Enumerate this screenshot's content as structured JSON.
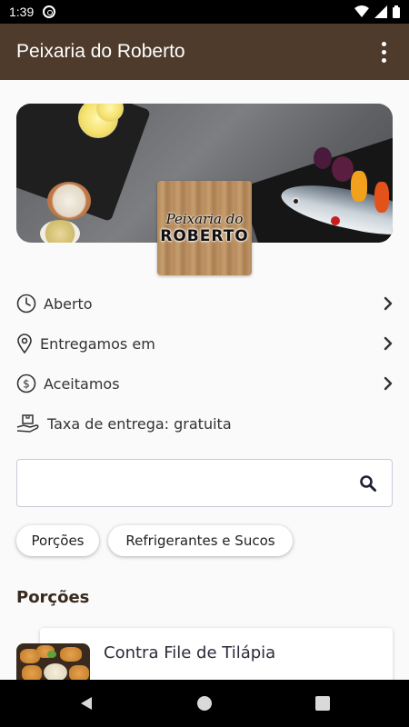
{
  "status": {
    "time": "1:39"
  },
  "app": {
    "title": "Peixaria do Roberto"
  },
  "logo": {
    "line1": "Peixaria do",
    "line2": "ROBERTO"
  },
  "info": [
    {
      "label": "Aberto",
      "icon": "clock-icon"
    },
    {
      "label": "Entregamos em",
      "icon": "location-pin-icon"
    },
    {
      "label": "Aceitamos",
      "icon": "dollar-icon"
    },
    {
      "label": "Taxa de entrega: gratuita",
      "icon": "delivery-hand-icon"
    }
  ],
  "search": {
    "value": "",
    "placeholder": ""
  },
  "categories": [
    {
      "label": "Porções"
    },
    {
      "label": "Refrigerantes e Sucos"
    }
  ],
  "section": {
    "title": "Porções"
  },
  "products": [
    {
      "name": "Contra File de Tilápia"
    }
  ],
  "colors": {
    "app_bar": "#4e3b2b",
    "accent": "#2b2b3a",
    "section_title": "#3a2a1e"
  }
}
